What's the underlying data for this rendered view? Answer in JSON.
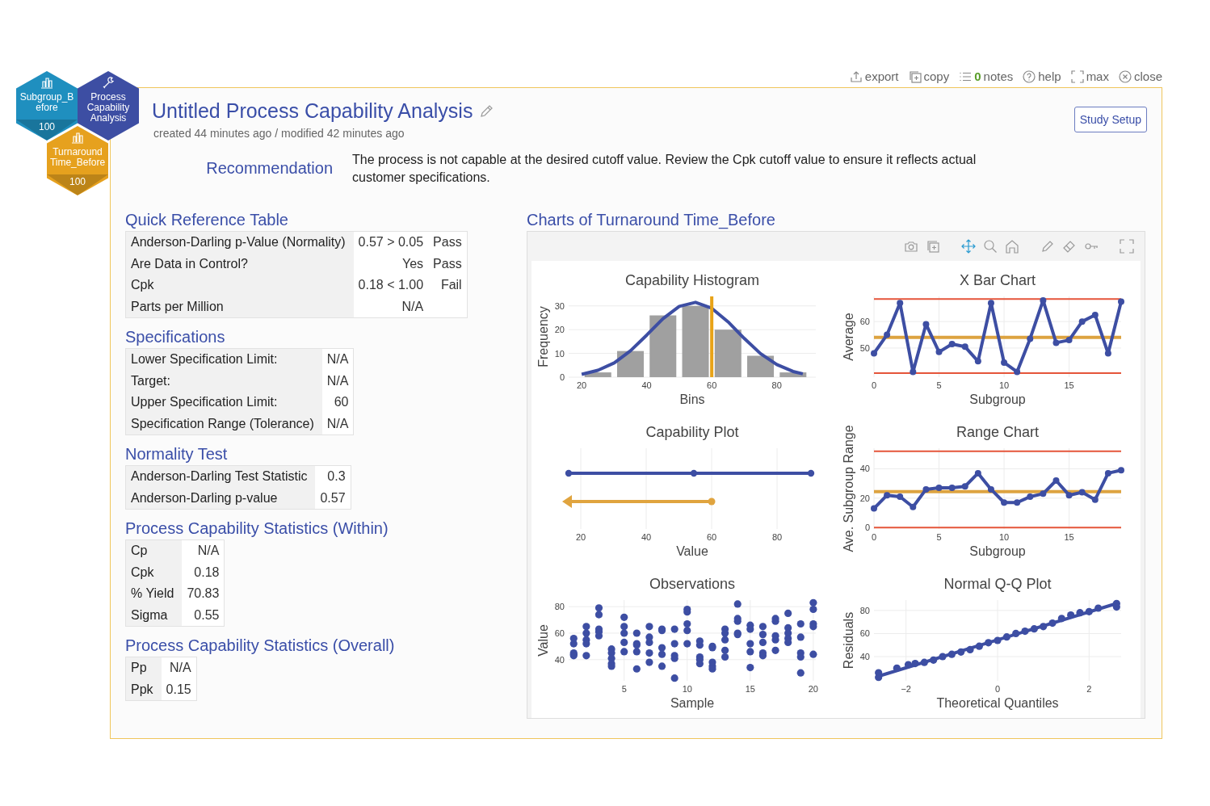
{
  "toolbar": [
    {
      "kind": "export",
      "label": "export"
    },
    {
      "kind": "copy",
      "label": "copy"
    },
    {
      "kind": "notes",
      "count": "0",
      "label": "notes"
    },
    {
      "kind": "help",
      "label": "help"
    },
    {
      "kind": "max",
      "label": "max"
    },
    {
      "kind": "close",
      "label": "close"
    }
  ],
  "workflow": [
    {
      "kind": "data",
      "label": "Subgroup_Before",
      "count": "100",
      "color": "#1f8fbf"
    },
    {
      "kind": "analysis",
      "label": "Process Capability Analysis",
      "color": "#3d4ea3"
    },
    {
      "kind": "data",
      "label": "Turnaround Time_Before",
      "count": "100",
      "color": "#e6a11e"
    }
  ],
  "study": {
    "title": "Untitled Process Capability Analysis",
    "meta": "created 44 minutes ago / modified 42 minutes ago",
    "setup_button": "Study Setup"
  },
  "recommendation": {
    "label": "Recommendation",
    "text": "The process is not capable at the desired cutoff value. Review the Cpk cutoff value to ensure it reflects actual customer specifications."
  },
  "tables": [
    {
      "title": "Quick Reference Table",
      "rows": [
        {
          "label": "Anderson-Darling p-Value (Normality)",
          "value": "0.57 > 0.05",
          "result": "Pass"
        },
        {
          "label": "Are Data in Control?",
          "value": "Yes",
          "result": "Pass"
        },
        {
          "label": "Cpk",
          "value": "0.18 < 1.00",
          "result": "Fail"
        },
        {
          "label": "Parts per Million",
          "value": "N/A"
        }
      ]
    },
    {
      "title": "Specifications",
      "rows": [
        {
          "label": "Lower Specification Limit:",
          "value": "N/A"
        },
        {
          "label": "Target:",
          "value": "N/A"
        },
        {
          "label": "Upper Specification Limit:",
          "value": "60"
        },
        {
          "label": "Specification Range (Tolerance)",
          "value": "N/A"
        }
      ]
    },
    {
      "title": "Normality Test",
      "rows": [
        {
          "label": "Anderson-Darling Test Statistic",
          "value": "0.3"
        },
        {
          "label": "Anderson-Darling p-value",
          "value": "0.57"
        }
      ]
    },
    {
      "title": "Process Capability Statistics (Within)",
      "rows": [
        {
          "label": "Cp",
          "value": "N/A"
        },
        {
          "label": "Cpk",
          "value": "0.18"
        },
        {
          "label": "% Yield",
          "value": "70.83"
        },
        {
          "label": "Sigma",
          "value": "0.55"
        }
      ]
    },
    {
      "title": "Process Capability Statistics (Overall)",
      "rows": [
        {
          "label": "Pp",
          "value": "N/A"
        },
        {
          "label": "Ppk",
          "value": "0.15"
        }
      ]
    }
  ],
  "charts": {
    "title": "Charts of Turnaround Time_Before",
    "tools": [
      {
        "kind": "camera",
        "selected": false
      },
      {
        "kind": "copy",
        "selected": false
      },
      {
        "kind": "pan",
        "selected": true
      },
      {
        "kind": "zoom",
        "selected": false
      },
      {
        "kind": "home",
        "selected": false
      },
      {
        "kind": "pencil",
        "selected": false
      },
      {
        "kind": "eraser",
        "selected": false
      },
      {
        "kind": "key",
        "selected": false
      },
      {
        "kind": "fullscreen",
        "selected": false
      }
    ],
    "items": [
      {
        "chart_data": {
          "type": "bar",
          "title": "Capability Histogram",
          "xlabel": "Bins",
          "ylabel": "Frequency",
          "grid": true,
          "xlim": [
            16,
            92
          ],
          "ylim": [
            0,
            34
          ],
          "xticks": [
            20,
            40,
            60,
            80
          ],
          "yticks": [
            0,
            10,
            20,
            30
          ],
          "series": [
            {
              "type": "bar",
              "color": "#a0a0a0",
              "x": [
                25,
                35,
                45,
                55,
                65,
                75,
                85
              ],
              "values": [
                2,
                11,
                26,
                30,
                20,
                9,
                2
              ]
            },
            {
              "type": "line",
              "color": "#3d4ea3",
              "x": [
                20,
                25,
                30,
                35,
                40,
                45,
                50,
                55,
                60,
                65,
                70,
                75,
                80,
                85,
                88
              ],
              "values": [
                1.2,
                2.9,
                6.0,
                11.1,
                17.7,
                24.6,
                29.8,
                31.5,
                29.0,
                23.3,
                16.3,
                9.9,
                5.3,
                2.4,
                1.4
              ]
            },
            {
              "type": "line",
              "color": "#e8a317",
              "x": [
                60,
                60
              ],
              "values": [
                0,
                34
              ]
            }
          ]
        }
      },
      {
        "chart_data": {
          "type": "line",
          "title": "X Bar Chart",
          "xlabel": "Subgroup",
          "ylabel": "Average",
          "grid": true,
          "xlim": [
            0,
            19
          ],
          "ylim": [
            39,
            69.5
          ],
          "xticks": [
            0,
            5,
            10,
            15
          ],
          "yticks": [
            50,
            60
          ],
          "series": [
            {
              "type": "line",
              "color": "#e5553a",
              "x": [
                0,
                19
              ],
              "values": [
                68.5,
                68.5
              ]
            },
            {
              "type": "line",
              "color": "#dda340",
              "x": [
                0,
                19
              ],
              "values": [
                54,
                54
              ]
            },
            {
              "type": "line",
              "color": "#e5553a",
              "x": [
                0,
                19
              ],
              "values": [
                40.5,
                40.5
              ]
            },
            {
              "type": "line",
              "marker": true,
              "color": "#3d4ea3",
              "x": [
                0,
                1,
                2,
                3,
                4,
                5,
                6,
                7,
                8,
                9,
                10,
                11,
                12,
                13,
                14,
                15,
                16,
                17,
                18,
                19
              ],
              "values": [
                48,
                55,
                67,
                41,
                59,
                48.5,
                51.5,
                50.5,
                45,
                67,
                44.5,
                41,
                53.5,
                68,
                52,
                53,
                60,
                62.5,
                48,
                67.5
              ]
            }
          ]
        }
      },
      {
        "plot": {
          "title": "Capability Plot",
          "xlabel": "Value",
          "xticks": [
            "20",
            "40",
            "60",
            "80"
          ]
        }
      },
      {
        "chart_data": {
          "type": "line",
          "title": "Range Chart",
          "xlabel": "Subgroup",
          "ylabel": "Ave. Subgroup Range",
          "grid": true,
          "xlim": [
            0,
            19
          ],
          "ylim": [
            -1,
            54
          ],
          "xticks": [
            0,
            5,
            10,
            15
          ],
          "yticks": [
            0,
            20,
            40
          ],
          "series": [
            {
              "type": "line",
              "color": "#e5553a",
              "x": [
                0,
                19
              ],
              "values": [
                52,
                52
              ]
            },
            {
              "type": "line",
              "color": "#dda340",
              "x": [
                0,
                19
              ],
              "values": [
                24.5,
                24.5
              ]
            },
            {
              "type": "line",
              "color": "#e5553a",
              "x": [
                0,
                19
              ],
              "values": [
                0,
                0
              ]
            },
            {
              "type": "line",
              "marker": true,
              "color": "#3d4ea3",
              "x": [
                0,
                1,
                2,
                3,
                4,
                5,
                6,
                7,
                8,
                9,
                10,
                11,
                12,
                13,
                14,
                15,
                16,
                17,
                18,
                19
              ],
              "values": [
                13,
                22,
                21,
                14,
                26,
                27,
                27,
                28,
                37,
                26,
                17,
                17,
                21,
                23,
                32,
                22,
                24,
                19,
                37,
                39
              ]
            }
          ]
        }
      },
      {
        "chart_data": {
          "type": "scatter",
          "title": "Observations",
          "xlabel": "Sample",
          "ylabel": "Value",
          "grid": true,
          "xlim": [
            0.6,
            20.2
          ],
          "ylim": [
            24,
            85
          ],
          "xticks": [
            5,
            10,
            15,
            20
          ],
          "yticks": [
            40,
            60,
            80
          ],
          "series": [
            {
              "type": "scatter",
              "color": "#3d4ea3",
              "x": [
                1,
                1,
                1,
                1,
                1,
                2,
                2,
                2,
                2,
                2,
                3,
                3,
                3,
                3,
                3,
                4,
                4,
                4,
                4,
                4,
                5,
                5,
                5,
                5,
                5,
                6,
                6,
                6,
                6,
                6,
                7,
                7,
                7,
                7,
                7,
                8,
                8,
                8,
                8,
                8,
                9,
                9,
                9,
                9,
                9,
                10,
                10,
                10,
                10,
                10,
                11,
                11,
                11,
                11,
                11,
                12,
                12,
                12,
                12,
                12,
                13,
                13,
                13,
                13,
                13,
                14,
                14,
                14,
                14,
                14,
                15,
                15,
                15,
                15,
                15,
                16,
                16,
                16,
                16,
                16,
                17,
                17,
                17,
                17,
                17,
                18,
                18,
                18,
                18,
                18,
                19,
                19,
                19,
                19,
                19,
                20,
                20,
                20,
                20,
                20
              ],
              "values": [
                56,
                52,
                45,
                44,
                43,
                65,
                60,
                55,
                52,
                43,
                79,
                74,
                63,
                61,
                58,
                48,
                45,
                41,
                37,
                35,
                72,
                65,
                60,
                53,
                46,
                60,
                52,
                51,
                46,
                33,
                65,
                57,
                53,
                45,
                38,
                63,
                62,
                49,
                44,
                35,
                63,
                52,
                43,
                41,
                26,
                78,
                76,
                67,
                62,
                52,
                54,
                51,
                42,
                40,
                37,
                50,
                49,
                38,
                35,
                33,
                63,
                60,
                55,
                47,
                42,
                82,
                71,
                69,
                60,
                59,
                66,
                63,
                52,
                46,
                34,
                65,
                59,
                53,
                45,
                43,
                71,
                69,
                58,
                55,
                47,
                75,
                64,
                60,
                56,
                53,
                67,
                57,
                45,
                42,
                30,
                83,
                78,
                67,
                65,
                44
              ]
            }
          ]
        }
      },
      {
        "chart_data": {
          "type": "scatter",
          "title": "Normal Q-Q Plot",
          "xlabel": "Theoretical Quantiles",
          "ylabel": "Residuals",
          "grid": true,
          "xlim": [
            -2.7,
            2.7
          ],
          "ylim": [
            19,
            89
          ],
          "xticks": [
            {
              "value": -2,
              "label": "−2"
            },
            0,
            2
          ],
          "yticks": [
            40,
            60,
            80
          ],
          "series": [
            {
              "type": "line",
              "color": "#3d4ea3",
              "x": [
                -2.6,
                2.6
              ],
              "values": [
                23,
                86
              ]
            },
            {
              "type": "scatter",
              "color": "#3d4ea3",
              "x": [
                -2.6,
                -2.6,
                -2.2,
                -1.95,
                -1.8,
                -1.6,
                -1.4,
                -1.2,
                -1.0,
                -0.8,
                -0.6,
                -0.4,
                -0.2,
                0,
                0.2,
                0.4,
                0.6,
                0.8,
                1.0,
                1.2,
                1.4,
                1.6,
                1.8,
                2.0,
                2.2,
                2.6,
                2.6
              ],
              "values": [
                26,
                22,
                30,
                33,
                34,
                35,
                37,
                40,
                42,
                44,
                46,
                49,
                52,
                54,
                57,
                60,
                62,
                64,
                66,
                69,
                73,
                76,
                78,
                79,
                82,
                86,
                83
              ]
            }
          ]
        }
      }
    ]
  }
}
